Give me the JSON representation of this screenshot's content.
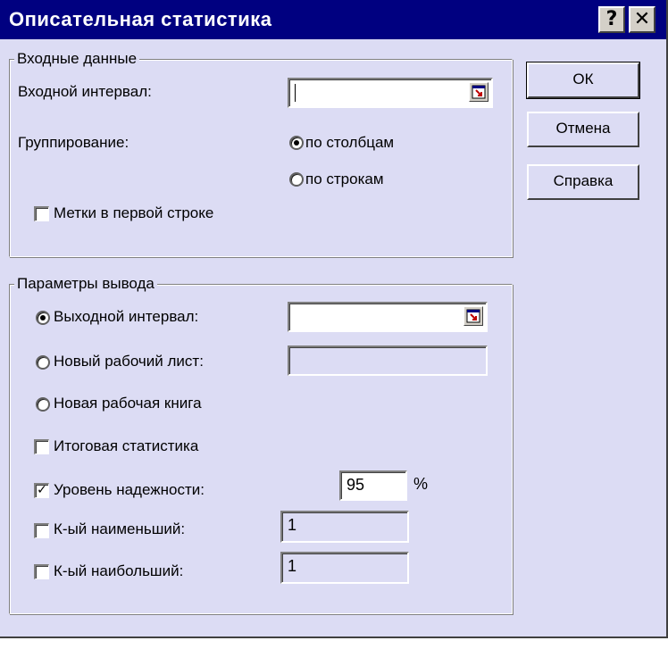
{
  "window": {
    "title": "Описательная статистика",
    "help_glyph": "?",
    "close_glyph": "✕"
  },
  "input_group": {
    "legend": "Входные данные",
    "input_range_label": "Входной интервал:",
    "input_range_value": "",
    "grouping_label": "Группирование:",
    "by_columns_label": "по столбцам",
    "by_rows_label": "по строкам",
    "grouping_selected": "по столбцам",
    "labels_first_row_label": "Метки в первой строке",
    "labels_first_row_checked": false
  },
  "output_group": {
    "legend": "Параметры вывода",
    "output_range_label": "Выходной интервал:",
    "output_range_value": "",
    "new_sheet_label": "Новый рабочий лист:",
    "new_sheet_value": "",
    "new_book_label": "Новая рабочая книга",
    "output_selected": "Выходной интервал:",
    "summary_stats_label": "Итоговая статистика",
    "summary_stats_checked": false,
    "confidence_label": "Уровень надежности:",
    "confidence_checked": true,
    "confidence_value": "95",
    "percent_sign": "%",
    "kth_smallest_label": "К-ый наименьший:",
    "kth_smallest_checked": false,
    "kth_smallest_value": "1",
    "kth_largest_label": "К-ый наибольший:",
    "kth_largest_checked": false,
    "kth_largest_value": "1"
  },
  "buttons": {
    "ok_label": "ОК",
    "cancel_label": "Отмена",
    "help_label": "Справка"
  },
  "icons": {
    "collapse": "collapse-dialog-icon",
    "help": "question-mark-icon",
    "close": "close-icon"
  },
  "colors": {
    "titlebar": "#000080",
    "dialog_bg": "#dcdcf4"
  }
}
